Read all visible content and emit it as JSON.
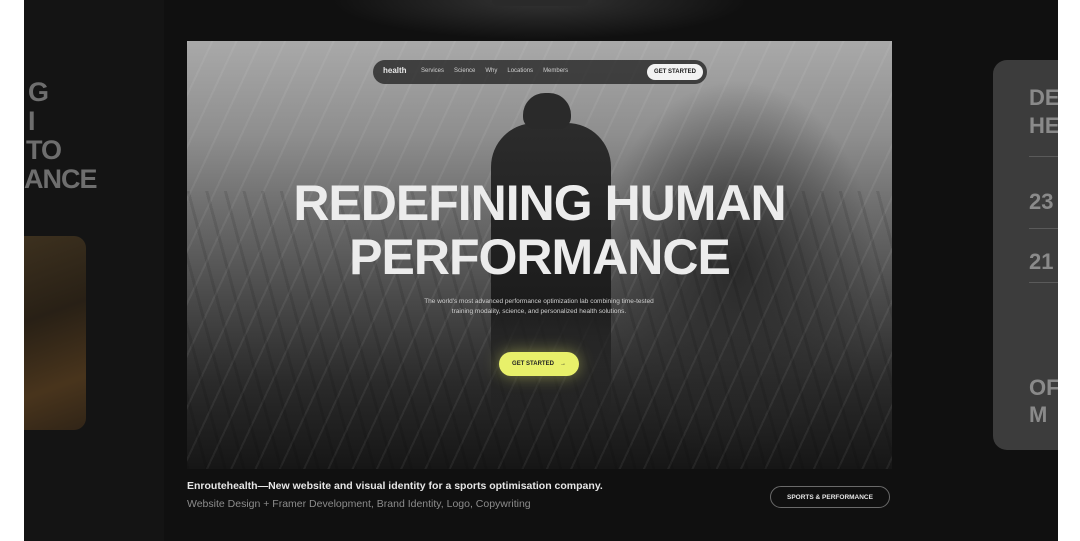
{
  "left_card": {
    "lines": [
      "G",
      "I",
      "TO",
      "ANCE"
    ]
  },
  "hero": {
    "nav": {
      "logo": "health",
      "links": [
        "Services",
        "Science",
        "Why",
        "Locations",
        "Members"
      ],
      "cta": "GET STARTED"
    },
    "headline": "REDEFINING HUMAN\nPERFORMANCE",
    "subtext": "The world's most advanced performance optimization lab combining time-tested training modality, science, and personalized health solutions.",
    "button_label": "GET STARTED",
    "button_arrow": "→"
  },
  "caption": {
    "title": "Enroutehealth—New website and visual identity for a sports optimisation company.",
    "services": "Website Design + Framer Development, Brand Identity, Logo, Copywriting",
    "tag": "SPORTS & PERFORMANCE"
  },
  "right_card": {
    "texts": [
      "DE",
      "HE",
      "23",
      "21",
      "OF",
      "M"
    ]
  },
  "colors": {
    "background": "#101010",
    "accent_button": "#e8f06a",
    "headline": "#ececec"
  }
}
